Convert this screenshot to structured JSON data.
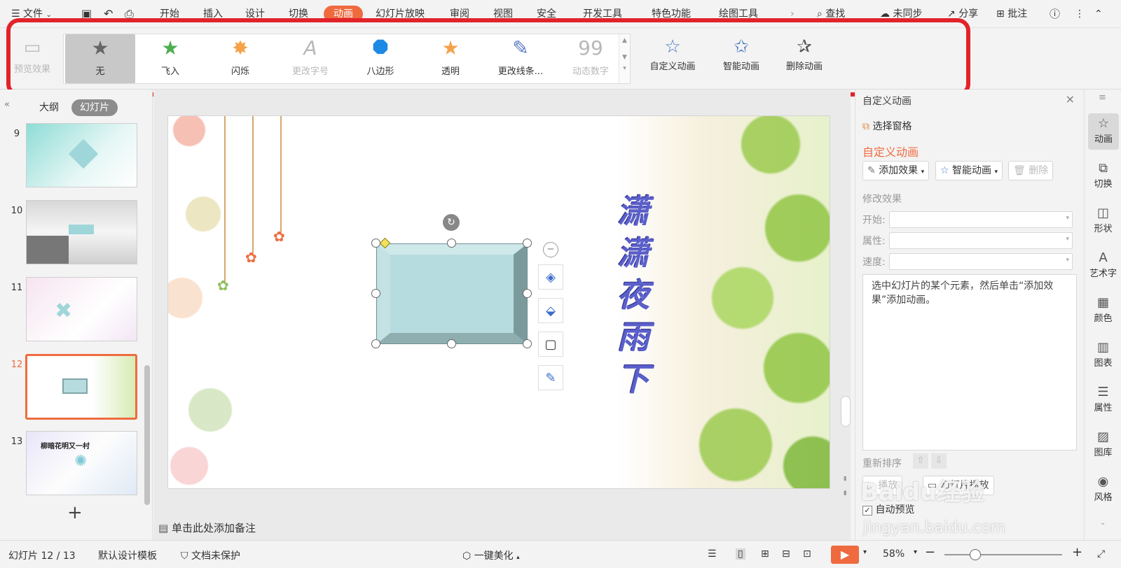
{
  "menu": {
    "file": "文件",
    "tabs": [
      "开始",
      "插入",
      "设计",
      "切换",
      "动画",
      "幻灯片放映",
      "审阅",
      "视图",
      "安全",
      "开发工具",
      "特色功能",
      "绘图工具"
    ],
    "active_tab": "动画",
    "search": "查找",
    "sync": "未同步",
    "share": "分享",
    "annotate": "批注"
  },
  "ribbon": {
    "preview": "预览效果",
    "gallery": [
      {
        "label": "无",
        "icon": "star-gray-icon",
        "selected": true,
        "disabled": false
      },
      {
        "label": "飞入",
        "icon": "star-green-fly-icon",
        "selected": false,
        "disabled": false
      },
      {
        "label": "闪烁",
        "icon": "star-orange-icon",
        "selected": false,
        "disabled": false
      },
      {
        "label": "更改字号",
        "icon": "font-size-icon",
        "selected": false,
        "disabled": true
      },
      {
        "label": "八边形",
        "icon": "octagon-icon",
        "selected": false,
        "disabled": false
      },
      {
        "label": "透明",
        "icon": "star-orange-icon",
        "selected": false,
        "disabled": false
      },
      {
        "label": "更改线条...",
        "icon": "pen-line-icon",
        "selected": false,
        "disabled": false
      },
      {
        "label": "动态数字",
        "icon": "number-99-icon",
        "selected": false,
        "disabled": true
      }
    ],
    "custom_anim": "自定义动画",
    "smart_anim": "智能动画",
    "delete_anim": "删除动画"
  },
  "left_panel": {
    "outline_tab": "大纲",
    "slides_tab": "幻灯片",
    "slide_numbers": [
      "9",
      "10",
      "11",
      "12",
      "13"
    ],
    "current_slide": "12",
    "thumb13_title": "柳暗花明又一村",
    "add_label": "+"
  },
  "slide": {
    "title_chars": [
      "潇",
      "潇",
      "夜",
      "雨",
      "下"
    ]
  },
  "notes_placeholder": "单击此处添加备注",
  "task_pane": {
    "header": "自定义动画",
    "select_pane": "选择窗格",
    "section_title": "自定义动画",
    "add_effect": "添加效果",
    "smart_anim": "智能动画",
    "delete": "删除",
    "modify_effect": "修改效果",
    "start_label": "开始:",
    "property_label": "属性:",
    "speed_label": "速度:",
    "hint": "选中幻灯片的某个元素，然后单击“添加效果”添加动画。",
    "reorder": "重新排序",
    "play": "播放",
    "slideshow": "幻灯片播放",
    "auto_preview": "自动预览",
    "auto_preview_checked": true
  },
  "right_bar": [
    {
      "label": "动画",
      "icon": "star-anim-icon",
      "active": true
    },
    {
      "label": "切换",
      "icon": "transition-icon",
      "active": false
    },
    {
      "label": "形状",
      "icon": "shapes-icon",
      "active": false
    },
    {
      "label": "艺术字",
      "icon": "wordart-icon",
      "active": false
    },
    {
      "label": "颜色",
      "icon": "color-grid-icon",
      "active": false
    },
    {
      "label": "图表",
      "icon": "chart-icon",
      "active": false
    },
    {
      "label": "属性",
      "icon": "sliders-icon",
      "active": false
    },
    {
      "label": "图库",
      "icon": "gallery-icon",
      "active": false
    },
    {
      "label": "风格",
      "icon": "style-icon",
      "active": false
    }
  ],
  "status": {
    "slide_counter": "幻灯片 12 / 13",
    "template": "默认设计模板",
    "protection": "文档未保护",
    "beautify": "一键美化",
    "zoom": "58%"
  },
  "watermark": {
    "brand": "Baidu经验",
    "url": "jingyan.baidu.com"
  },
  "colors": {
    "accent": "#ef6b3f",
    "highlight_box": "#e2232a",
    "shape_fill": "#b6dcdf",
    "title_text": "#5b5fc9"
  }
}
